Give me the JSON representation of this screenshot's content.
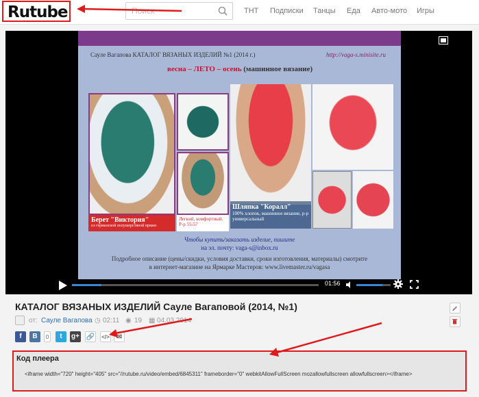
{
  "header": {
    "logo": "Rutube",
    "search_placeholder": "Поиск",
    "nav": [
      "ТНТ",
      "Подписки",
      "Танцы",
      "Еда",
      "Авто-мото",
      "Игры"
    ]
  },
  "player": {
    "time": "01:56",
    "progress_fraction": 0.12,
    "volume_fraction": 0.75,
    "slide": {
      "title": "Сауле Вагапова  КАТАЛОГ ВЯЗАНЫХ ИЗДЕЛИЙ  №1 (2014 г.)",
      "url": "http://vaga-s.minisite.ru",
      "season_prefix": "весна – ЛЕТО – осень",
      "season_suffix": " (машинное вязание)",
      "beret_label": "Берет \"Виктория\"",
      "beret_sub": "из германской полушерстяной пряжи",
      "beret_desc": "Легкий, комфортный. Р-р 55-57",
      "hat_label": "Шляпка \"Коралл\"",
      "hat_desc": "100% хлопок, машинное вязание, р-р универсальный",
      "buy_text": "Чтобы купить/заказать изделие, пишите",
      "mail_text": "на эл. почту: vaga-s@inbox.ru",
      "desc_line1": "Подробное описание (цены/скидки, условия доставки, сроки изготовления, материалы) смотрите",
      "desc_line2": "в интернет-магазине на Ярмарке Мастеров: www.livemaster.ru/vagasa"
    }
  },
  "video": {
    "title": "КАТАЛОГ ВЯЗАНЫХ ИЗДЕЛИЙ Сауле Вагаповой (2014, №1)",
    "author_prefix": "от:",
    "author": "Сауле Вагапова",
    "duration": "02:11",
    "views": "19",
    "date": "04.03.2014"
  },
  "share": {
    "facebook": "f",
    "vkontakte": "B",
    "count": "0",
    "twitter": "t",
    "googleplus": "g+",
    "link": "🔗",
    "embed": "</>",
    "email": "✉"
  },
  "embed": {
    "title": "Код плеера",
    "code": "<iframe width=\"720\" height=\"405\" src=\"//rutube.ru/video/embed/6845311\" frameborder=\"0\" webkitAllowFullScreen mozallowfullscreen allowfullscreen></iframe>"
  },
  "colors": {
    "accent": "#3a87d6",
    "annotation_red": "#e01a1a"
  }
}
